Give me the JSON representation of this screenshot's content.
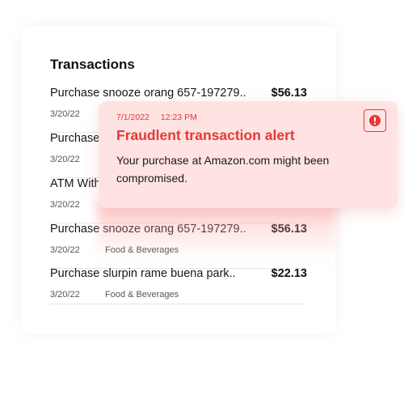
{
  "transactions": {
    "title": "Transactions",
    "rows": [
      {
        "description": "Purchase snooze orang 657-197279..",
        "amount": "$56.13",
        "date": "3/20/22",
        "category": ""
      },
      {
        "description": "Purchase",
        "amount": "",
        "date": "3/20/22",
        "category": ""
      },
      {
        "description": "ATM With",
        "amount": "",
        "date": "3/20/22",
        "category": ""
      },
      {
        "description": "Purchase snooze orang 657-197279..",
        "amount": "$56.13",
        "date": "3/20/22",
        "category": "Food & Beverages"
      },
      {
        "description": "Purchase slurpin rame buena park..",
        "amount": "$22.13",
        "date": "3/20/22",
        "category": "Food & Beverages"
      }
    ]
  },
  "alert": {
    "date": "7/1/2022",
    "time": "12:23 PM",
    "heading": "Fraudlent transaction alert",
    "message": "Your purchase at Amazon.com might been compromised.",
    "icon": "exclamation-circle-icon",
    "accent_color": "#e53935",
    "background_color": "#ffe3e3"
  }
}
